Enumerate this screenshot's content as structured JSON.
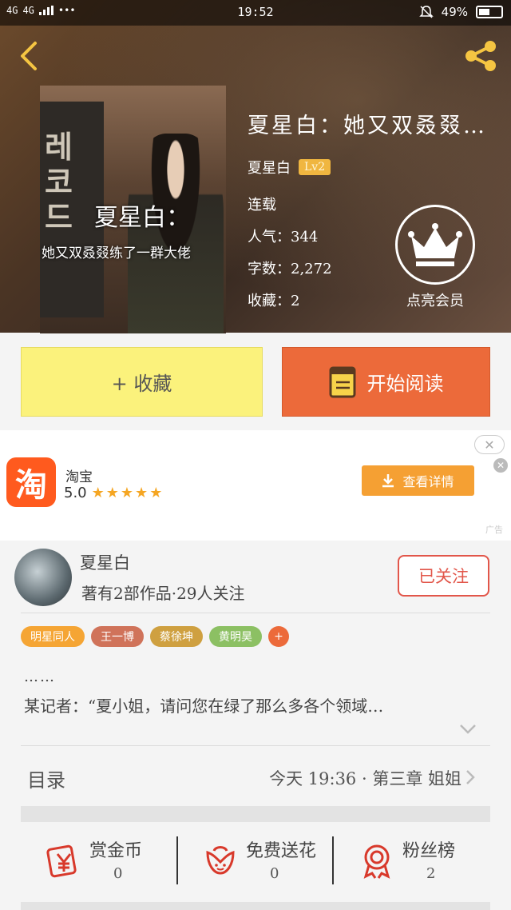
{
  "status_bar": {
    "network1": "4G",
    "network2": "4G",
    "dots": "•••",
    "time": "19:52",
    "battery": "49%",
    "battery_level": 0.49
  },
  "book": {
    "title": "夏星白：她又双叒叕…",
    "cover_title": "夏星白：",
    "cover_subtitle": "她又双叒叕练了一群大佬",
    "cover_korean": "레\n코\n드",
    "author": "夏星白",
    "level": "Lv2",
    "status": "连载",
    "popularity": "人气：344",
    "words": "字数：2,272",
    "favorites": "收藏：2"
  },
  "vip": {
    "label": "点亮会员"
  },
  "actions": {
    "collect_label": "+ 收藏",
    "read_label": "开始阅读"
  },
  "ad": {
    "icon_text": "淘",
    "app_name": "淘宝",
    "rating": "5.0",
    "stars": "★★★★★",
    "button_label": "查看详情",
    "close": "✕",
    "tag": "广告"
  },
  "author_card": {
    "name": "夏星白",
    "meta": "著有2部作品·29人关注",
    "follow_label": "已关注"
  },
  "tags": [
    {
      "label": "明星同人",
      "color": "#f5a534"
    },
    {
      "label": "王一博",
      "color": "#d0735a"
    },
    {
      "label": "蔡徐坤",
      "color": "#cfa040"
    },
    {
      "label": "黄明昊",
      "color": "#8cc063"
    },
    {
      "label": "+",
      "color": "#ec6a3a"
    }
  ],
  "description": {
    "line1": "……",
    "line2": "某记者：“夏小姐，请问您在绿了那么多各个领域…"
  },
  "toc": {
    "label": "目录",
    "latest": "今天 19:36 · 第三章 姐姐"
  },
  "stats": [
    {
      "label": "赏金币",
      "value": "0",
      "icon": "gold-coin-icon"
    },
    {
      "label": "免费送花",
      "value": "0",
      "icon": "flower-icon"
    },
    {
      "label": "粉丝榜",
      "value": "2",
      "icon": "medal-icon"
    }
  ],
  "colors": {
    "accent": "#ec6a3a",
    "collect_bg": "#fbf27c",
    "follow": "#e2564a",
    "header_icons": "#f5c542"
  }
}
